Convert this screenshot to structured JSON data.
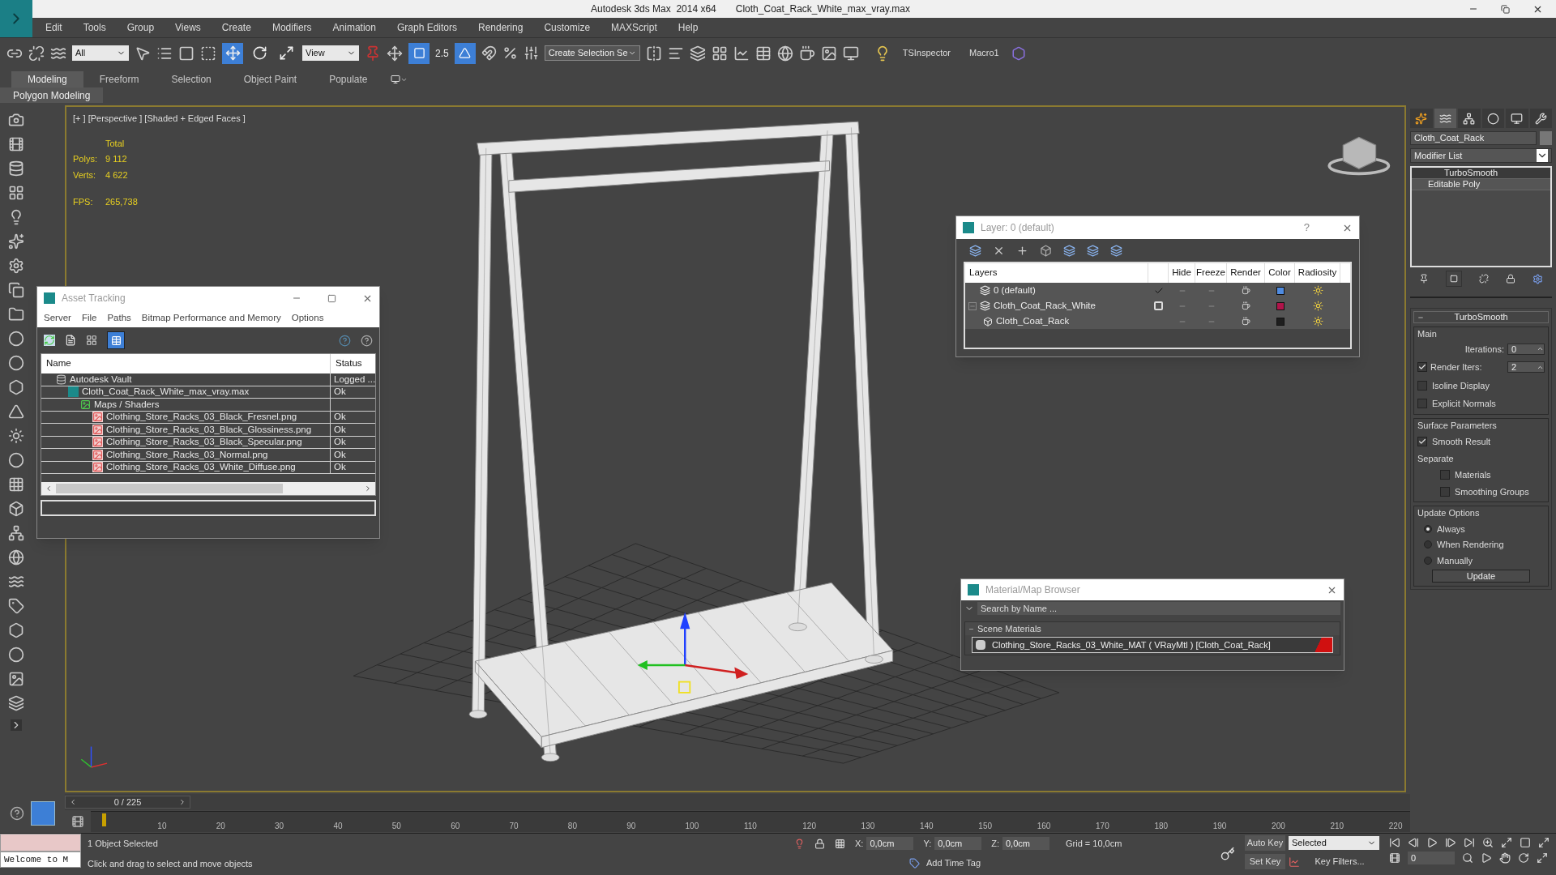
{
  "window": {
    "app": "Autodesk 3ds Max  2014 x64",
    "file": "Cloth_Coat_Rack_White_max_vray.max"
  },
  "menu": [
    "Edit",
    "Tools",
    "Group",
    "Views",
    "Create",
    "Modifiers",
    "Animation",
    "Graph Editors",
    "Rendering",
    "Customize",
    "MAXScript",
    "Help"
  ],
  "toolbar": {
    "selection_filter": "All",
    "reference_coord": "View",
    "snap_value": "2.5",
    "named_selection": "Create Selection Se",
    "plugins": [
      "TSInspector",
      "Macro1"
    ]
  },
  "ribbon": {
    "tabs": [
      {
        "label": "Modeling",
        "selected": true
      },
      {
        "label": "Freeform",
        "selected": false
      },
      {
        "label": "Selection",
        "selected": false
      },
      {
        "label": "Object Paint",
        "selected": false
      },
      {
        "label": "Populate",
        "selected": false
      }
    ],
    "panel_label": "Polygon Modeling"
  },
  "viewport": {
    "label": "[+ ] [Perspective ] [Shaded + Edged Faces ]",
    "stats_header": "Total",
    "stats": [
      {
        "label": "Polys:",
        "value": "9 112"
      },
      {
        "label": "Verts:",
        "value": "4 622"
      }
    ],
    "fps_label": "FPS:",
    "fps": "265,738"
  },
  "asset_tracking": {
    "title": "Asset Tracking",
    "menu": [
      "Server",
      "File",
      "Paths",
      "Bitmap Performance and Memory",
      "Options"
    ],
    "columns": [
      "Name",
      "Status"
    ],
    "tree": [
      {
        "kind": "vault",
        "name": "Autodesk Vault",
        "status": "Logged ...",
        "children": [
          {
            "kind": "scene",
            "name": "Cloth_Coat_Rack_White_max_vray.max",
            "status": "Ok",
            "children": [
              {
                "kind": "folder",
                "name": "Maps / Shaders",
                "children": [
                  {
                    "kind": "bitmap",
                    "name": "Clothing_Store_Racks_03_Black_Fresnel.png",
                    "status": "Ok"
                  },
                  {
                    "kind": "bitmap",
                    "name": "Clothing_Store_Racks_03_Black_Glossiness.png",
                    "status": "Ok"
                  },
                  {
                    "kind": "bitmap",
                    "name": "Clothing_Store_Racks_03_Black_Specular.png",
                    "status": "Ok"
                  },
                  {
                    "kind": "bitmap",
                    "name": "Clothing_Store_Racks_03_Normal.png",
                    "status": "Ok"
                  },
                  {
                    "kind": "bitmap",
                    "name": "Clothing_Store_Racks_03_White_Diffuse.png",
                    "status": "Ok"
                  }
                ]
              }
            ]
          }
        ]
      }
    ]
  },
  "layer_dialog": {
    "title": "Layer: 0 (default)",
    "help": "?",
    "columns": [
      "Layers",
      "Hide",
      "Freeze",
      "Render",
      "Color",
      "Radiosity"
    ],
    "rows": [
      {
        "kind": "layer",
        "name": "0 (default)",
        "current": true,
        "color": "#4f8be0"
      },
      {
        "kind": "layer",
        "name": "Cloth_Coat_Rack_White",
        "current": false,
        "expanded": true,
        "color": "#b0144a",
        "children": [
          {
            "kind": "object",
            "name": "Cloth_Coat_Rack",
            "color": "#1e1e1e"
          }
        ]
      }
    ]
  },
  "material_browser": {
    "title": "Material/Map Browser",
    "search_placeholder": "Search by Name ...",
    "group": "Scene Materials",
    "items": [
      "Clothing_Store_Racks_03_White_MAT ( VRayMtl ) [Cloth_Coat_Rack]"
    ]
  },
  "command_panel": {
    "tabs": [
      {
        "selected": false
      },
      {
        "selected": true
      },
      {
        "selected": false
      },
      {
        "selected": false
      },
      {
        "selected": false
      },
      {
        "selected": false
      }
    ],
    "object_name": "Cloth_Coat_Rack",
    "modifier_list": "Modifier List",
    "stack": [
      {
        "name": "TurboSmooth",
        "selected": true
      },
      {
        "name": "Editable Poly",
        "selected": false
      }
    ],
    "rollout": "TurboSmooth",
    "main_group": "Main",
    "iterations_label": "Iterations:",
    "iterations": "0",
    "render_iters_label": "Render Iters:",
    "render_iters_checked": true,
    "render_iters": "2",
    "main_checks": [
      {
        "label": "Isoline Display",
        "checked": false
      },
      {
        "label": "Explicit Normals",
        "checked": false
      }
    ],
    "surface_group": "Surface Parameters",
    "smooth_result": {
      "label": "Smooth Result",
      "checked": true
    },
    "separate_label": "Separate",
    "separate_checks": [
      {
        "label": "Materials",
        "checked": false
      },
      {
        "label": "Smoothing Groups",
        "checked": false
      }
    ],
    "update_group": "Update Options",
    "update_options": [
      {
        "label": "Always",
        "selected": true
      },
      {
        "label": "When Rendering",
        "selected": false
      },
      {
        "label": "Manually",
        "selected": false
      }
    ],
    "update_button": "Update"
  },
  "timeline": {
    "frame": "0 / 225",
    "level": 0,
    "ticks": [
      "10",
      "20",
      "30",
      "40",
      "50",
      "60",
      "70",
      "80",
      "90",
      "100",
      "110",
      "120",
      "130",
      "140",
      "150",
      "160",
      "170",
      "180",
      "190",
      "200",
      "210",
      "220"
    ]
  },
  "status": {
    "listener": "Welcome to M",
    "selection": "1 Object Selected",
    "prompt": "Click and drag to select and move objects",
    "coords": [
      {
        "label": "X:",
        "value": "0,0cm"
      },
      {
        "label": "Y:",
        "value": "0,0cm"
      },
      {
        "label": "Z:",
        "value": "0,0cm"
      }
    ],
    "grid": "Grid = 10,0cm",
    "add_time_tag": "Add Time Tag",
    "auto_key": "Auto Key",
    "set_key": "Set Key",
    "key_mode": "Selected",
    "key_filters": "Key Filters...",
    "current_frame": "0"
  }
}
